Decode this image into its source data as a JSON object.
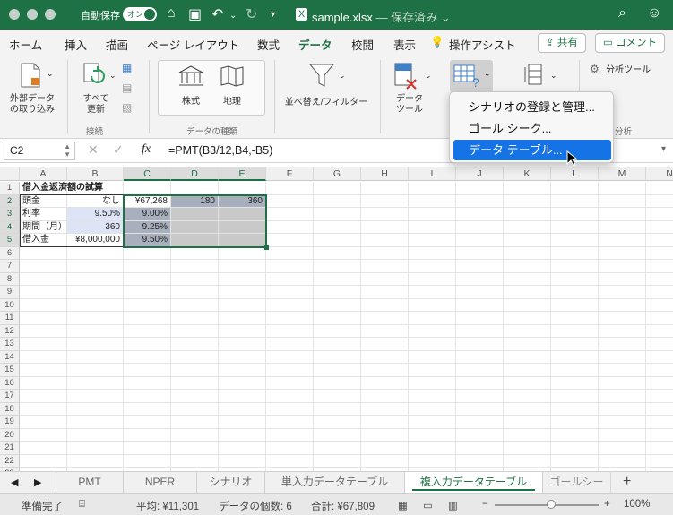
{
  "titlebar": {
    "autosave_label": "自動保存",
    "toggle_label": "オン",
    "file_name": "sample.xlsx",
    "file_status": "— 保存済み",
    "file_status_suffix": "⌄"
  },
  "tabs": {
    "items": [
      "ホーム",
      "挿入",
      "描画",
      "ページ レイアウト",
      "数式",
      "データ",
      "校閲",
      "表示"
    ],
    "assist": "操作アシスト",
    "share": "共有",
    "comment": "コメント"
  },
  "ribbon": {
    "external_data": "外部データ\nの取り込み",
    "refresh_all": "すべて\n更新",
    "stocks": "株式",
    "geography": "地理",
    "sort_filter": "並べ替え/フィルター",
    "data_tools": "データ\nツール",
    "analysis_tools": "分析ツール",
    "group_connections": "接続",
    "group_data_types": "データの種類",
    "group_analysis": "分析"
  },
  "dropdown": {
    "items": [
      "シナリオの登録と管理...",
      "ゴール シーク...",
      "データ テーブル..."
    ]
  },
  "formula_bar": {
    "name_box": "C2",
    "fx": "fx",
    "formula": "=PMT(B3/12,B4,-B5)"
  },
  "grid": {
    "columns": [
      "A",
      "B",
      "C",
      "D",
      "E",
      "F",
      "G",
      "H",
      "I",
      "J",
      "K",
      "L",
      "M",
      "N"
    ],
    "rows": [
      "1",
      "2",
      "3",
      "4",
      "5",
      "6",
      "7",
      "8",
      "9",
      "10",
      "11",
      "12",
      "13",
      "14",
      "15",
      "16",
      "17",
      "18",
      "19",
      "20",
      "21",
      "22",
      "23"
    ],
    "title": "借入金返済額の試算",
    "cells": {
      "A2": "頭金",
      "B2": "なし",
      "C2": "¥67,268",
      "D2": "180",
      "E2": "360",
      "A3": "利率",
      "B3": "9.50%",
      "C3": "9.00%",
      "A4": "期間（月）",
      "B4": "360",
      "C4": "9.25%",
      "A5": "借入金",
      "B5": "¥8,000,000",
      "C5": "9.50%"
    }
  },
  "sheets": {
    "items": [
      "PMT",
      "NPER",
      "シナリオ",
      "単入力データテーブル",
      "複入力データテーブル",
      "ゴールシー"
    ],
    "active_index": 4,
    "add": "+"
  },
  "status": {
    "ready": "準備完了",
    "average": "平均: ¥11,301",
    "count": "データの個数: 6",
    "sum": "合計: ¥67,809",
    "zoom_out": "−",
    "zoom_in": "+",
    "zoom": "100%"
  }
}
